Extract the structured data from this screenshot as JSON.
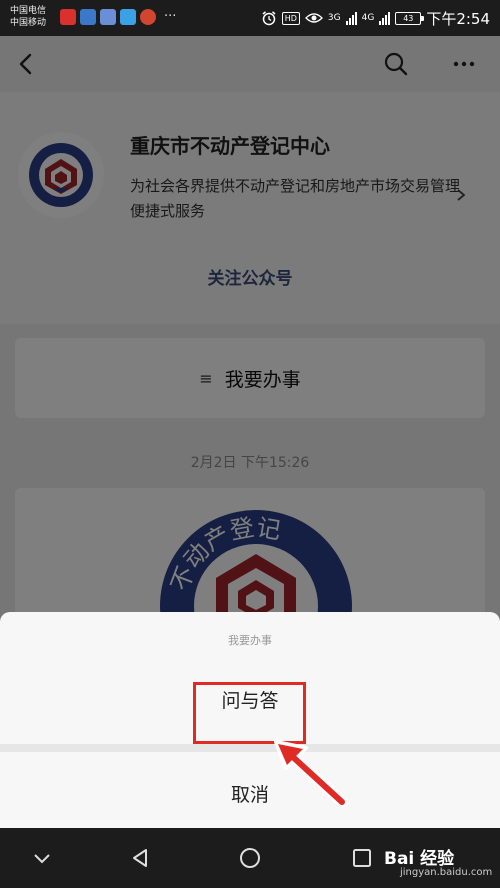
{
  "status_bar": {
    "carrier_1": "中国电信",
    "carrier_2": "中国移动",
    "notif_icons": [
      "app-icon-red",
      "app-icon-blue",
      "app-icon-blue-2",
      "app-icon-light-blue",
      "app-icon-orange"
    ],
    "more": "···",
    "hd": "HD",
    "net_3g": "3G",
    "net_4g": "4G",
    "battery": "43",
    "time": "下午2:54"
  },
  "profile": {
    "name": "重庆市不动产登记中心",
    "description": "为社会各界提供不动产登记和房地产市场交易管理便捷式服务",
    "follow_label": "关注公众号"
  },
  "menu": {
    "icon": "≡",
    "label": "我要办事"
  },
  "message": {
    "timestamp": "2月2日 下午15:26",
    "logo_text": "不动产登记"
  },
  "action_sheet": {
    "title": "我要办事",
    "option": "问与答",
    "cancel": "取消"
  },
  "watermark": {
    "text": "Bai 经验",
    "url": "jingyan.baidu.com"
  },
  "colors": {
    "highlight": "#e02a26",
    "follow_link": "#3c4c7a",
    "logo_navy": "#2b3f86",
    "logo_red": "#a3242a"
  }
}
